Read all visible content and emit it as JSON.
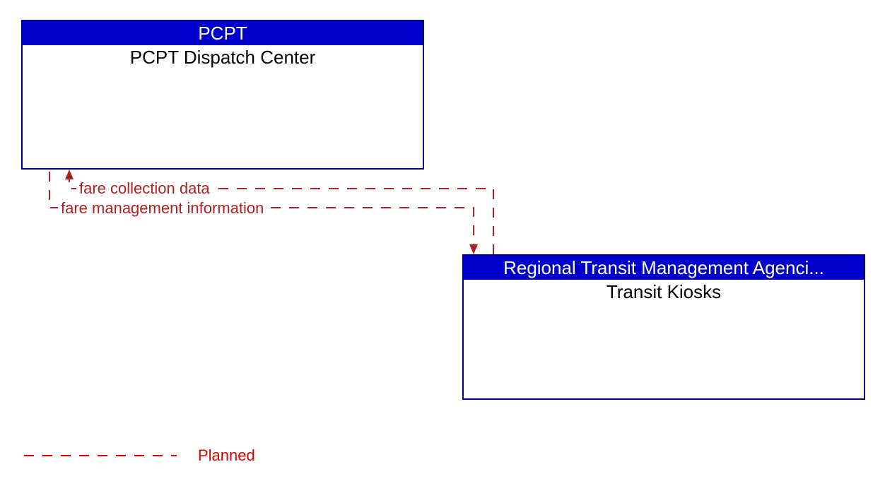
{
  "boxes": {
    "pcpt": {
      "header": "PCPT",
      "body": "PCPT Dispatch Center"
    },
    "kiosks": {
      "header": "Regional Transit Management Agenci...",
      "body": "Transit Kiosks"
    }
  },
  "flows": {
    "fare_collection": "fare collection data",
    "fare_management": "fare management information"
  },
  "legend": {
    "planned": "Planned"
  },
  "colors": {
    "header_bg": "#0000cc",
    "border": "#000080",
    "flow": "#b02020",
    "legend": "#e00000"
  }
}
